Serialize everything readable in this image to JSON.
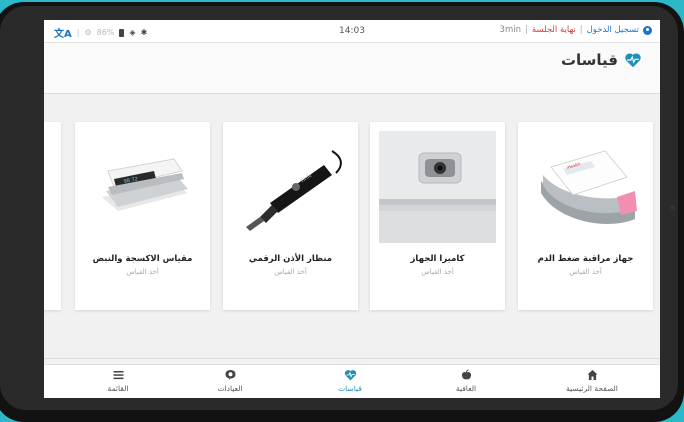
{
  "statusbar": {
    "time": "14:03",
    "battery": "86%",
    "login_label": "تسجيل الدخول",
    "logout_label": "نهاية الجلسة",
    "separator": "|",
    "session_timer": "3min"
  },
  "header": {
    "title": "قياسات"
  },
  "cards": [
    {
      "title": "جهاز مراقبة ضغط الدم",
      "subtitle": "أخذ القياس"
    },
    {
      "title": "كاميرا الجهاز",
      "subtitle": "أخذ القياس"
    },
    {
      "title": "منظار الأذن الرقمي",
      "subtitle": "أخذ القياس"
    },
    {
      "title": "مقياس الاكسجة والنبض",
      "subtitle": "أخذ القياس"
    }
  ],
  "nav": [
    {
      "label": "الصفحة الرئيسية",
      "icon": "home-icon"
    },
    {
      "label": "العافية",
      "icon": "apple-icon"
    },
    {
      "label": "قياسات",
      "icon": "heart-pulse-icon"
    },
    {
      "label": "العيادات",
      "icon": "chat-icon"
    },
    {
      "label": "القائمة",
      "icon": "menu-icon"
    }
  ],
  "colors": {
    "accent": "#1e8fb8",
    "logout": "#d23b3b",
    "login": "#1a73c9"
  }
}
